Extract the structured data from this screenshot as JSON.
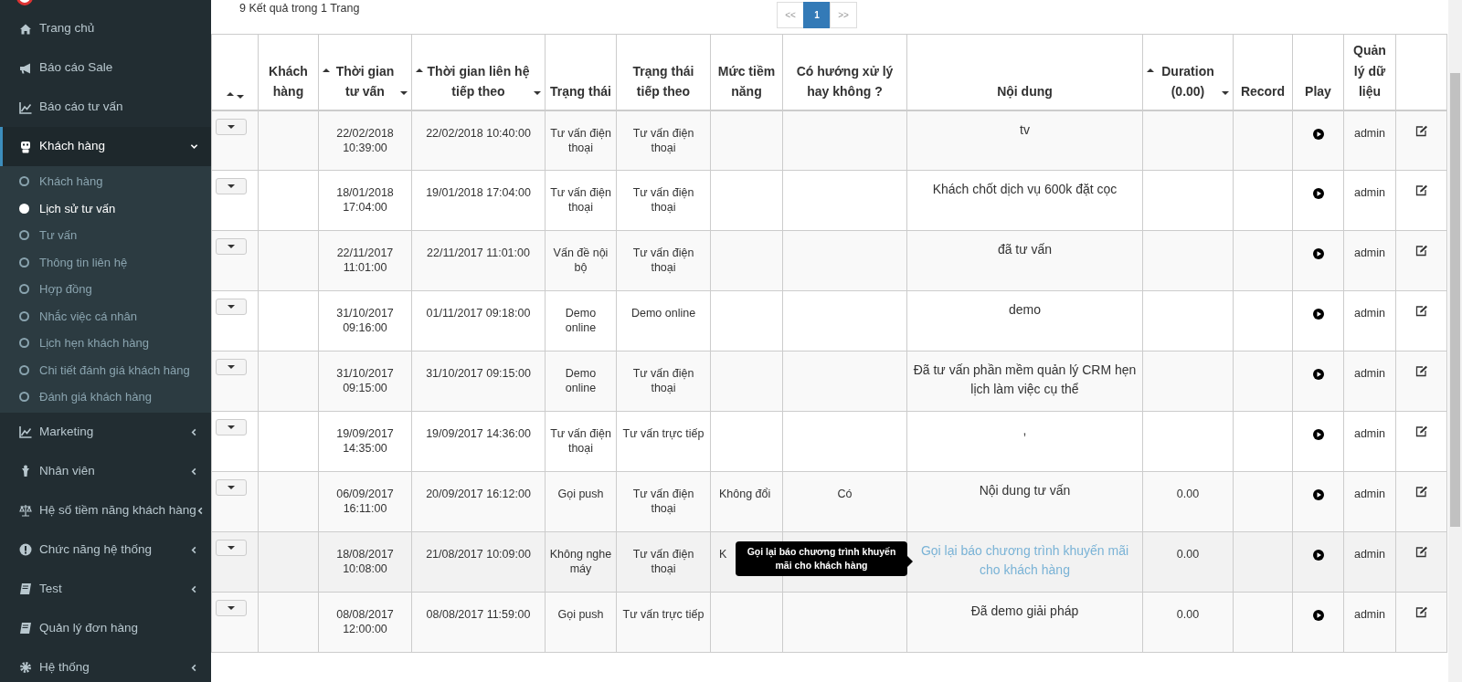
{
  "sidebar": {
    "items": [
      {
        "label": "Trang chủ",
        "selected": false
      },
      {
        "label": "Báo cáo Sale",
        "selected": false
      },
      {
        "label": "Báo cáo tư vấn",
        "selected": false
      },
      {
        "label": "Khách hàng",
        "selected": true,
        "expanded": true,
        "children": [
          {
            "label": "Khách hàng",
            "selected": false
          },
          {
            "label": "Lịch sử tư vấn",
            "selected": true
          },
          {
            "label": "Tư vấn",
            "selected": false
          },
          {
            "label": "Thông tin liên hệ",
            "selected": false
          },
          {
            "label": "Hợp đồng",
            "selected": false
          },
          {
            "label": "Nhắc việc cá nhân",
            "selected": false
          },
          {
            "label": "Lịch hẹn khách hàng",
            "selected": false
          },
          {
            "label": "Chi tiết đánh giá khách hàng",
            "selected": false
          },
          {
            "label": "Đánh giá khách hàng",
            "selected": false
          }
        ]
      },
      {
        "label": "Marketing",
        "selected": false,
        "expanded": false
      },
      {
        "label": "Nhân viên",
        "selected": false,
        "expanded": false
      },
      {
        "label": "Hệ số tiềm năng khách hàng",
        "selected": false,
        "expanded": false
      },
      {
        "label": "Chức năng hệ thống",
        "selected": false,
        "expanded": false
      },
      {
        "label": "Test",
        "selected": false,
        "expanded": false
      },
      {
        "label": "Quản lý đơn hàng",
        "selected": false
      },
      {
        "label": "Hệ thống",
        "selected": false,
        "expanded": false
      }
    ]
  },
  "summary": "9 Kết quả trong 1 Trang",
  "pagination": [
    {
      "label": "<<",
      "selected": false
    },
    {
      "label": "1",
      "selected": true
    },
    {
      "label": ">>",
      "selected": false
    }
  ],
  "table": {
    "columns": [
      {
        "sortable": true
      },
      {
        "label": "Khách hàng",
        "sortable": false
      },
      {
        "label": "Thời gian tư vấn",
        "sortable": true
      },
      {
        "label": "Thời gian liên hệ tiếp theo",
        "sortable": true
      },
      {
        "label": "Trạng thái",
        "sortable": false
      },
      {
        "label": "Trạng thái tiếp theo",
        "sortable": false
      },
      {
        "label": "Mức tiềm năng",
        "sortable": false
      },
      {
        "label": "Có hướng xử lý hay không ?",
        "sortable": false
      },
      {
        "label": "Nội dung",
        "sortable": false
      },
      {
        "label": "Duration (0.00)",
        "sortable": true
      },
      {
        "label": "Record",
        "sortable": false
      },
      {
        "label": "Play",
        "sortable": false
      },
      {
        "label": "Quản lý dữ liệu",
        "sortable": false
      },
      {
        "sortable": false
      }
    ],
    "rows": [
      {
        "time": "22/02/2018 10:39:00",
        "next_time": "22/02/2018 10:40:00",
        "status": "Tư vấn điện thoại",
        "next_status": "Tư vấn điện thoại",
        "content": "tv",
        "user": "admin",
        "hovered": false
      },
      {
        "time": "18/01/2018 17:04:00",
        "next_time": "19/01/2018 17:04:00",
        "status": "Tư vấn điện thoại",
        "next_status": "Tư vấn điện thoại",
        "content": "Khách chốt dịch vụ 600k đặt cọc",
        "user": "admin",
        "hovered": false
      },
      {
        "time": "22/11/2017 11:01:00",
        "next_time": "22/11/2017 11:01:00",
        "status": "Vấn đề nội bộ",
        "next_status": "Tư vấn điện thoại",
        "content": "đã tư vấn",
        "user": "admin",
        "hovered": false
      },
      {
        "time": "31/10/2017 09:16:00",
        "next_time": "01/11/2017 09:18:00",
        "status": "Demo online",
        "next_status": "Demo online",
        "content": "demo",
        "user": "admin",
        "hovered": false
      },
      {
        "time": "31/10/2017 09:15:00",
        "next_time": "31/10/2017 09:15:00",
        "status": "Demo online",
        "next_status": "Tư vấn điện thoại",
        "content": "Đã tư vấn phần mềm quản lý CRM hẹn lịch làm việc cụ thể",
        "user": "admin",
        "hovered": false
      },
      {
        "time": "19/09/2017 14:35:00",
        "next_time": "19/09/2017 14:36:00",
        "status": "Tư vấn điện thoại",
        "next_status": "Tư vấn trực tiếp",
        "content": ",",
        "user": "admin",
        "hovered": false
      },
      {
        "time": "06/09/2017 16:11:00",
        "next_time": "20/09/2017 16:12:00",
        "status": "Gọi push",
        "next_status": "Tư vấn điện thoại",
        "potential": "Không đổi",
        "handled": "Có",
        "content": "Nội dung tư vấn",
        "duration": "0.00",
        "user": "admin",
        "hovered": false
      },
      {
        "time": "18/08/2017 10:08:00",
        "next_time": "21/08/2017 10:09:00",
        "status": "Không nghe máy",
        "next_status": "Tư vấn điện thoại",
        "potential": "K",
        "content": "Gọi lại báo chương trình khuyến mãi cho khách hàng",
        "duration": "0.00",
        "user": "admin",
        "hovered": true,
        "tooltip": "Gọi lại báo chương trình khuyến mãi cho khách hàng"
      },
      {
        "time": "08/08/2017 12:00:00",
        "next_time": "08/08/2017 11:59:00",
        "status": "Gọi push",
        "next_status": "Tư vấn trực tiếp",
        "content": "Đã demo giải pháp",
        "duration": "0.00",
        "user": "admin",
        "hovered": false
      }
    ]
  }
}
